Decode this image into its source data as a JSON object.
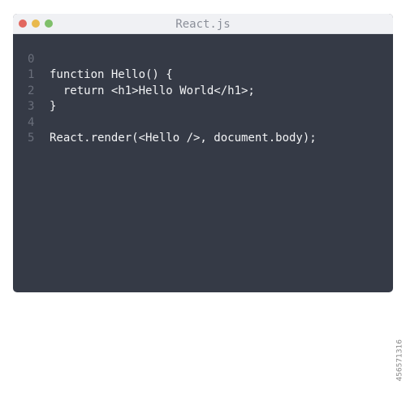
{
  "window": {
    "title": "React.js",
    "controls": [
      {
        "name": "close",
        "color": "#e2675e"
      },
      {
        "name": "minimize",
        "color": "#e9b94c"
      },
      {
        "name": "maximize",
        "color": "#7fbf6a"
      }
    ]
  },
  "editor": {
    "lines": [
      {
        "number": "0",
        "code": "function Hello() {"
      },
      {
        "number": "1",
        "code": "  return <h1>Hello World</h1>;"
      },
      {
        "number": "2",
        "code": "}"
      },
      {
        "number": "3",
        "code": ""
      },
      {
        "number": "4",
        "code": "React.render(<Hello />, document.body);"
      },
      {
        "number": "5",
        "code": ""
      }
    ]
  },
  "side_text": "456571316",
  "colors": {
    "editor_bg": "#353a46",
    "titlebar_bg": "#f0f1f4",
    "code_text": "#f2f3f5",
    "line_number": "#6a6f7b"
  }
}
